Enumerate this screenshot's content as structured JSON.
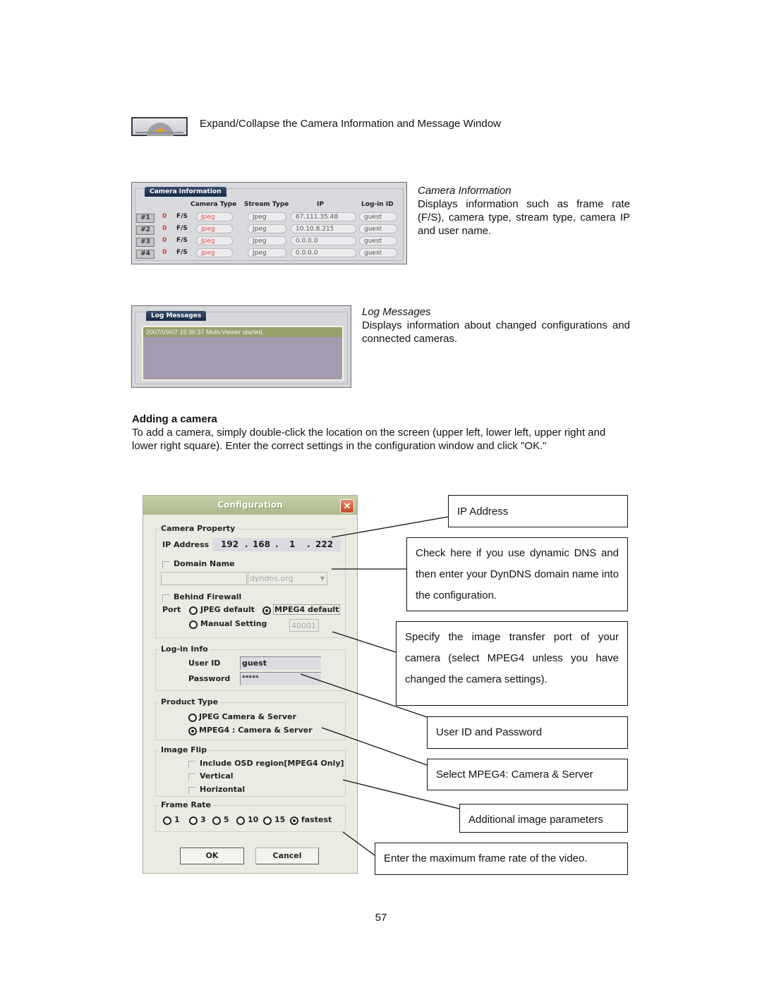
{
  "expand_section": {
    "icon": "expand-collapse-icon",
    "description": "Expand/Collapse the Camera Information and Message Window"
  },
  "camera_info": {
    "panel_title": "Camera Information",
    "columns": [
      "Camera Type",
      "Stream Type",
      "IP",
      "Log-in ID"
    ],
    "rows": [
      {
        "num": "#1",
        "fps": "0",
        "fs": "F/S",
        "camera_type": "Jpeg",
        "stream_type": "Jpeg",
        "ip": "67.111.35.48",
        "login": "guest"
      },
      {
        "num": "#2",
        "fps": "0",
        "fs": "F/S",
        "camera_type": "Jpeg",
        "stream_type": "Jpeg",
        "ip": "10.10.8.215",
        "login": "guest"
      },
      {
        "num": "#3",
        "fps": "0",
        "fs": "F/S",
        "camera_type": "Jpeg",
        "stream_type": "Jpeg",
        "ip": "0.0.0.0",
        "login": "guest"
      },
      {
        "num": "#4",
        "fps": "0",
        "fs": "F/S",
        "camera_type": "Jpeg",
        "stream_type": "Jpeg",
        "ip": "0.0.0.0",
        "login": "guest"
      }
    ],
    "heading": "Camera Information",
    "description": "Displays information such as frame rate (F/S), camera type, stream type, camera IP and user name."
  },
  "log_messages": {
    "panel_title": "Log Messages",
    "entries": [
      "2007/09/07 15:36:37  Multi-Viewer started."
    ],
    "heading": "Log Messages",
    "description": "Displays information about changed configurations and connected cameras."
  },
  "adding_camera": {
    "heading": "Adding a camera",
    "body": "To add a camera, simply double-click the location on the screen (upper left, lower left, upper right and lower right square). Enter the correct settings in the configuration window and click \"OK.\""
  },
  "config_dialog": {
    "title": "Configuration",
    "close_icon": "close-icon",
    "camera_property": {
      "label": "Camera Property",
      "ip_label": "IP Address",
      "ip": [
        "192",
        "168",
        "1",
        "222"
      ],
      "ip_sep": ".",
      "domain_name_label": "Domain Name",
      "domain_name_checked": false,
      "domain_value": "",
      "domain_suffix": "dyndns.org",
      "behind_firewall_label": "Behind Firewall",
      "behind_firewall_checked": false,
      "port_label": "Port",
      "port_options": [
        "JPEG default",
        "MPEG4 default",
        "Manual Setting"
      ],
      "port_selected": "MPEG4 default",
      "manual_port": "40001"
    },
    "login_info": {
      "label": "Log-in Info",
      "user_id_label": "User ID",
      "user_id": "guest",
      "password_label": "Password",
      "password": "*****"
    },
    "product_type": {
      "label": "Product Type",
      "options": [
        "JPEG Camera & Server",
        "MPEG4 : Camera & Server"
      ],
      "selected": "MPEG4 : Camera & Server"
    },
    "image_flip": {
      "label": "Image Flip",
      "options": [
        "Include OSD region[MPEG4 Only]",
        "Vertical",
        "Horizontal"
      ],
      "checked": [
        false,
        false,
        false
      ]
    },
    "frame_rate": {
      "label": "Frame Rate",
      "options": [
        "1",
        "3",
        "5",
        "10",
        "15",
        "fastest"
      ],
      "selected": "fastest"
    },
    "ok_label": "OK",
    "cancel_label": "Cancel"
  },
  "callouts": {
    "ip_address": "IP Address",
    "dynamic_dns": "Check here if you use dynamic DNS and then enter your DynDNS domain name into the configuration.",
    "port": "Specify the image transfer port of your camera (select MPEG4 unless you have changed the camera settings).",
    "user_pass": "User ID and Password",
    "product": "Select MPEG4: Camera & Server",
    "image_params": "Additional image parameters",
    "frame_rate": "Enter the maximum frame rate of the video."
  },
  "page_number": "57"
}
